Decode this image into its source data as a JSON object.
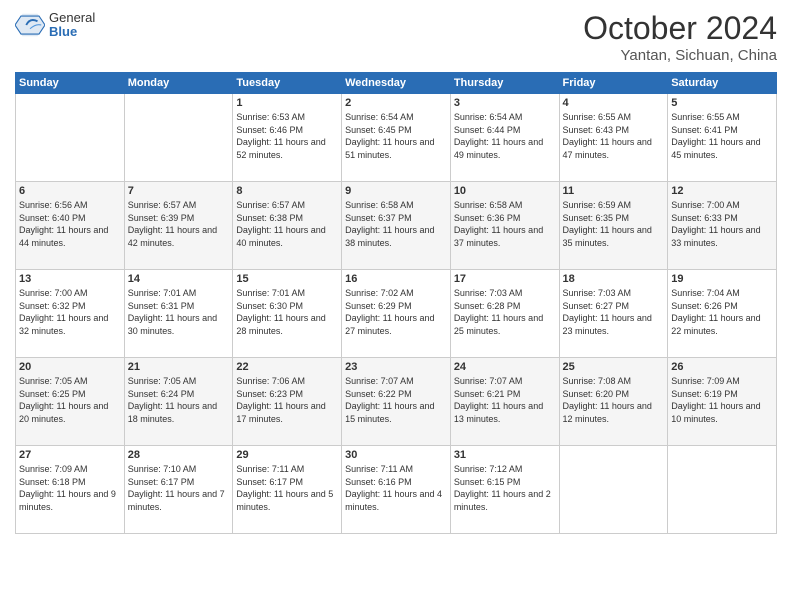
{
  "header": {
    "logo": {
      "general": "General",
      "blue": "Blue"
    },
    "title": "October 2024",
    "location": "Yantan, Sichuan, China"
  },
  "days_of_week": [
    "Sunday",
    "Monday",
    "Tuesday",
    "Wednesday",
    "Thursday",
    "Friday",
    "Saturday"
  ],
  "weeks": [
    [
      {
        "day": "",
        "sunrise": "",
        "sunset": "",
        "daylight": ""
      },
      {
        "day": "",
        "sunrise": "",
        "sunset": "",
        "daylight": ""
      },
      {
        "day": "1",
        "sunrise": "Sunrise: 6:53 AM",
        "sunset": "Sunset: 6:46 PM",
        "daylight": "Daylight: 11 hours and 52 minutes."
      },
      {
        "day": "2",
        "sunrise": "Sunrise: 6:54 AM",
        "sunset": "Sunset: 6:45 PM",
        "daylight": "Daylight: 11 hours and 51 minutes."
      },
      {
        "day": "3",
        "sunrise": "Sunrise: 6:54 AM",
        "sunset": "Sunset: 6:44 PM",
        "daylight": "Daylight: 11 hours and 49 minutes."
      },
      {
        "day": "4",
        "sunrise": "Sunrise: 6:55 AM",
        "sunset": "Sunset: 6:43 PM",
        "daylight": "Daylight: 11 hours and 47 minutes."
      },
      {
        "day": "5",
        "sunrise": "Sunrise: 6:55 AM",
        "sunset": "Sunset: 6:41 PM",
        "daylight": "Daylight: 11 hours and 45 minutes."
      }
    ],
    [
      {
        "day": "6",
        "sunrise": "Sunrise: 6:56 AM",
        "sunset": "Sunset: 6:40 PM",
        "daylight": "Daylight: 11 hours and 44 minutes."
      },
      {
        "day": "7",
        "sunrise": "Sunrise: 6:57 AM",
        "sunset": "Sunset: 6:39 PM",
        "daylight": "Daylight: 11 hours and 42 minutes."
      },
      {
        "day": "8",
        "sunrise": "Sunrise: 6:57 AM",
        "sunset": "Sunset: 6:38 PM",
        "daylight": "Daylight: 11 hours and 40 minutes."
      },
      {
        "day": "9",
        "sunrise": "Sunrise: 6:58 AM",
        "sunset": "Sunset: 6:37 PM",
        "daylight": "Daylight: 11 hours and 38 minutes."
      },
      {
        "day": "10",
        "sunrise": "Sunrise: 6:58 AM",
        "sunset": "Sunset: 6:36 PM",
        "daylight": "Daylight: 11 hours and 37 minutes."
      },
      {
        "day": "11",
        "sunrise": "Sunrise: 6:59 AM",
        "sunset": "Sunset: 6:35 PM",
        "daylight": "Daylight: 11 hours and 35 minutes."
      },
      {
        "day": "12",
        "sunrise": "Sunrise: 7:00 AM",
        "sunset": "Sunset: 6:33 PM",
        "daylight": "Daylight: 11 hours and 33 minutes."
      }
    ],
    [
      {
        "day": "13",
        "sunrise": "Sunrise: 7:00 AM",
        "sunset": "Sunset: 6:32 PM",
        "daylight": "Daylight: 11 hours and 32 minutes."
      },
      {
        "day": "14",
        "sunrise": "Sunrise: 7:01 AM",
        "sunset": "Sunset: 6:31 PM",
        "daylight": "Daylight: 11 hours and 30 minutes."
      },
      {
        "day": "15",
        "sunrise": "Sunrise: 7:01 AM",
        "sunset": "Sunset: 6:30 PM",
        "daylight": "Daylight: 11 hours and 28 minutes."
      },
      {
        "day": "16",
        "sunrise": "Sunrise: 7:02 AM",
        "sunset": "Sunset: 6:29 PM",
        "daylight": "Daylight: 11 hours and 27 minutes."
      },
      {
        "day": "17",
        "sunrise": "Sunrise: 7:03 AM",
        "sunset": "Sunset: 6:28 PM",
        "daylight": "Daylight: 11 hours and 25 minutes."
      },
      {
        "day": "18",
        "sunrise": "Sunrise: 7:03 AM",
        "sunset": "Sunset: 6:27 PM",
        "daylight": "Daylight: 11 hours and 23 minutes."
      },
      {
        "day": "19",
        "sunrise": "Sunrise: 7:04 AM",
        "sunset": "Sunset: 6:26 PM",
        "daylight": "Daylight: 11 hours and 22 minutes."
      }
    ],
    [
      {
        "day": "20",
        "sunrise": "Sunrise: 7:05 AM",
        "sunset": "Sunset: 6:25 PM",
        "daylight": "Daylight: 11 hours and 20 minutes."
      },
      {
        "day": "21",
        "sunrise": "Sunrise: 7:05 AM",
        "sunset": "Sunset: 6:24 PM",
        "daylight": "Daylight: 11 hours and 18 minutes."
      },
      {
        "day": "22",
        "sunrise": "Sunrise: 7:06 AM",
        "sunset": "Sunset: 6:23 PM",
        "daylight": "Daylight: 11 hours and 17 minutes."
      },
      {
        "day": "23",
        "sunrise": "Sunrise: 7:07 AM",
        "sunset": "Sunset: 6:22 PM",
        "daylight": "Daylight: 11 hours and 15 minutes."
      },
      {
        "day": "24",
        "sunrise": "Sunrise: 7:07 AM",
        "sunset": "Sunset: 6:21 PM",
        "daylight": "Daylight: 11 hours and 13 minutes."
      },
      {
        "day": "25",
        "sunrise": "Sunrise: 7:08 AM",
        "sunset": "Sunset: 6:20 PM",
        "daylight": "Daylight: 11 hours and 12 minutes."
      },
      {
        "day": "26",
        "sunrise": "Sunrise: 7:09 AM",
        "sunset": "Sunset: 6:19 PM",
        "daylight": "Daylight: 11 hours and 10 minutes."
      }
    ],
    [
      {
        "day": "27",
        "sunrise": "Sunrise: 7:09 AM",
        "sunset": "Sunset: 6:18 PM",
        "daylight": "Daylight: 11 hours and 9 minutes."
      },
      {
        "day": "28",
        "sunrise": "Sunrise: 7:10 AM",
        "sunset": "Sunset: 6:17 PM",
        "daylight": "Daylight: 11 hours and 7 minutes."
      },
      {
        "day": "29",
        "sunrise": "Sunrise: 7:11 AM",
        "sunset": "Sunset: 6:17 PM",
        "daylight": "Daylight: 11 hours and 5 minutes."
      },
      {
        "day": "30",
        "sunrise": "Sunrise: 7:11 AM",
        "sunset": "Sunset: 6:16 PM",
        "daylight": "Daylight: 11 hours and 4 minutes."
      },
      {
        "day": "31",
        "sunrise": "Sunrise: 7:12 AM",
        "sunset": "Sunset: 6:15 PM",
        "daylight": "Daylight: 11 hours and 2 minutes."
      },
      {
        "day": "",
        "sunrise": "",
        "sunset": "",
        "daylight": ""
      },
      {
        "day": "",
        "sunrise": "",
        "sunset": "",
        "daylight": ""
      }
    ]
  ]
}
